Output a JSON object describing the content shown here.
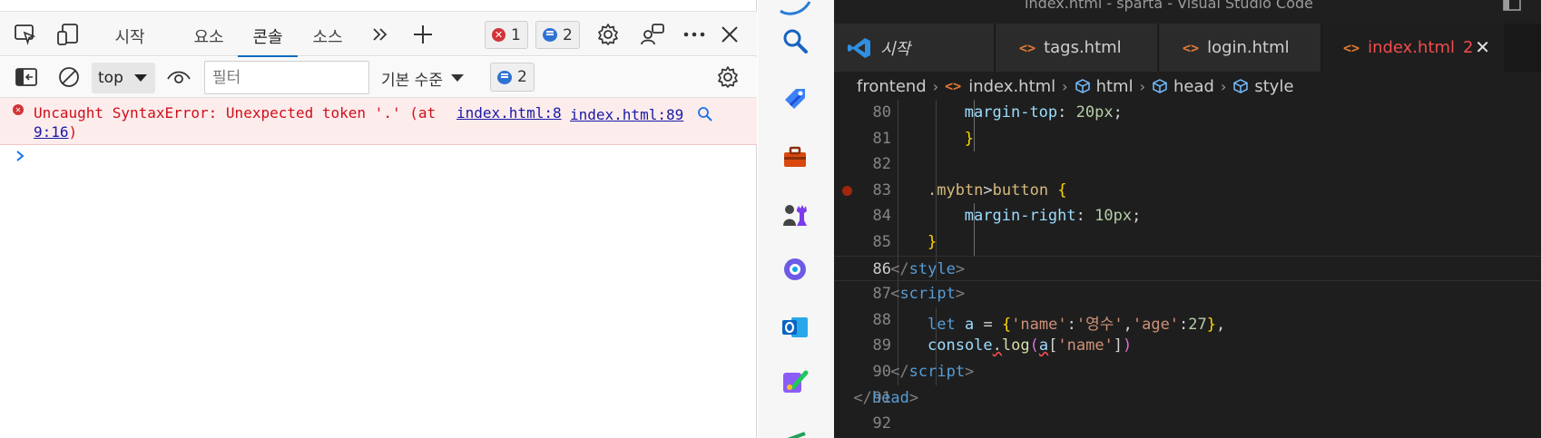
{
  "devtools": {
    "tabs": [
      {
        "label": "시작"
      },
      {
        "label": "요소"
      },
      {
        "label": "콘솔",
        "active": true
      },
      {
        "label": "소스"
      }
    ],
    "error_count": "1",
    "message_count": "2",
    "toolbar": {
      "context": "top",
      "filter_placeholder": "필터",
      "level": "기본 수준",
      "issues_count": "2"
    },
    "console": {
      "error_message": "Uncaught SyntaxError: Unexpected token '.' (at ",
      "error_link_part1": "index.html:8",
      "error_link_part2": "9:16",
      "error_close": ")",
      "error_source": "index.html:89"
    },
    "colors": {
      "error_text": "#d00f1a",
      "error_bg": "#fdecec",
      "accent": "#0f6cbd"
    }
  },
  "activity_bar": {
    "icons": [
      "search-icon",
      "extensions-tag-icon",
      "toolbox-icon",
      "chess-icon",
      "copilot-icon",
      "outlook-icon",
      "paint-icon"
    ]
  },
  "vscode": {
    "window_title": "index.html - sparta - Visual Studio Code",
    "tabs": [
      {
        "label": "시작",
        "kind": "welcome"
      },
      {
        "label": "tags.html",
        "kind": "html"
      },
      {
        "label": "login.html",
        "kind": "html"
      },
      {
        "label": "index.html",
        "kind": "html",
        "active": true,
        "problems": "2"
      }
    ],
    "breadcrumb": [
      "frontend",
      "index.html",
      "html",
      "head",
      "style"
    ],
    "current_line": "86",
    "lines": [
      {
        "n": "80",
        "tokens": [
          [
            "t-prop",
            "margin-top"
          ],
          [
            "t-text",
            ": "
          ],
          [
            "t-num",
            "20px"
          ],
          [
            "t-text",
            ";"
          ]
        ]
      },
      {
        "n": "81",
        "tokens": [
          [
            "t-brace",
            "}"
          ]
        ]
      },
      {
        "n": "82",
        "tokens": []
      },
      {
        "n": "83",
        "tokens": [
          [
            "t-sel",
            ".mybtn"
          ],
          [
            "t-text",
            ">"
          ],
          [
            "t-sel",
            "button"
          ],
          [
            "t-text",
            " "
          ],
          [
            "t-brace",
            "{"
          ]
        ]
      },
      {
        "n": "84",
        "tokens": [
          [
            "t-prop",
            "margin-right"
          ],
          [
            "t-text",
            ": "
          ],
          [
            "t-num",
            "10px"
          ],
          [
            "t-text",
            ";"
          ]
        ]
      },
      {
        "n": "85",
        "tokens": [
          [
            "t-brace",
            "}"
          ]
        ]
      },
      {
        "n": "86",
        "tokens": [
          [
            "t-angle",
            "</"
          ],
          [
            "t-tag",
            "style"
          ],
          [
            "t-angle",
            ">"
          ]
        ]
      },
      {
        "n": "87",
        "tokens": [
          [
            "t-angle",
            "<"
          ],
          [
            "t-tag",
            "script"
          ],
          [
            "t-angle",
            ">"
          ]
        ]
      },
      {
        "n": "88",
        "tokens": [
          [
            "t-kw",
            "let"
          ],
          [
            "t-text",
            " "
          ],
          [
            "t-var",
            "a"
          ],
          [
            "t-text",
            " = "
          ],
          [
            "t-brace",
            "{"
          ],
          [
            "t-str",
            "'name'"
          ],
          [
            "t-text",
            ":"
          ],
          [
            "t-str",
            "'영수'"
          ],
          [
            "t-text",
            ","
          ],
          [
            "t-str",
            "'age'"
          ],
          [
            "t-text",
            ":"
          ],
          [
            "t-num",
            "27"
          ],
          [
            "t-brace",
            "}"
          ],
          [
            "t-text",
            ","
          ]
        ]
      },
      {
        "n": "89",
        "tokens": [
          [
            "t-var",
            "console"
          ],
          [
            "t-text squig",
            "."
          ],
          [
            "t-fn",
            "log"
          ],
          [
            "t-brace2",
            "("
          ],
          [
            "t-var squig",
            "a"
          ],
          [
            "t-text",
            "["
          ],
          [
            "t-str",
            "'name'"
          ],
          [
            "t-text",
            "]"
          ],
          [
            "t-brace2",
            ")"
          ]
        ]
      },
      {
        "n": "90",
        "tokens": [
          [
            "t-angle",
            "</"
          ],
          [
            "t-tag",
            "script"
          ],
          [
            "t-angle",
            ">"
          ]
        ]
      },
      {
        "n": "91",
        "tokens": [
          [
            "t-angle",
            "</"
          ],
          [
            "t-tag",
            "head"
          ],
          [
            "t-angle",
            ">"
          ]
        ]
      },
      {
        "n": "92",
        "tokens": []
      }
    ]
  }
}
